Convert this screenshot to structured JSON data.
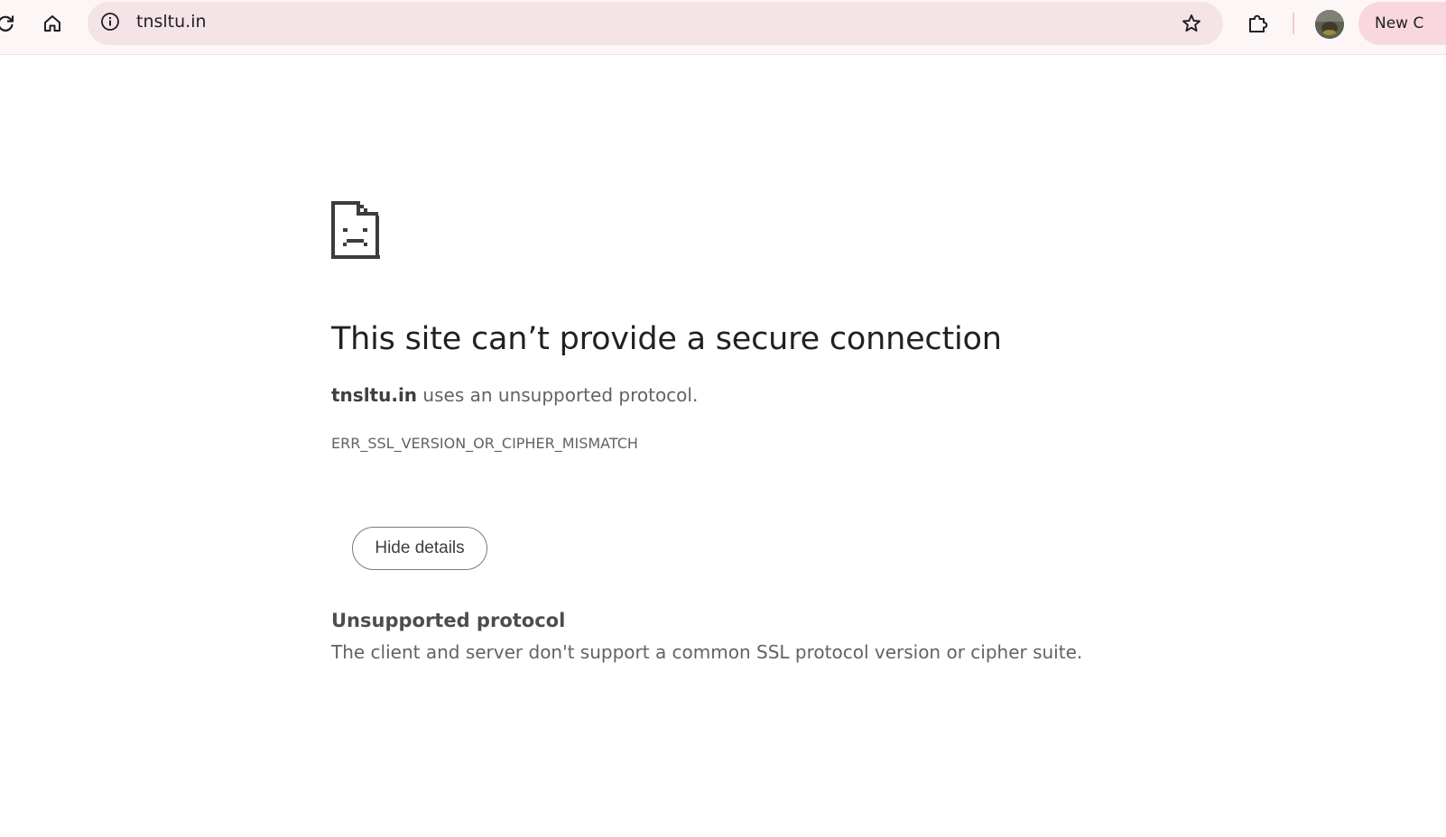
{
  "browser": {
    "url": "tnsltu.in",
    "new_chip_label": "New C",
    "icons": {
      "reload": "reload-icon",
      "home": "home-icon",
      "site_info": "info-icon",
      "bookmark": "star-icon",
      "extensions": "puzzle-icon",
      "avatar": "profile-avatar"
    },
    "colors": {
      "toolbar_bg": "#fdf6f7",
      "omnibox_bg": "#f4e3e7",
      "chip_bg": "#f8d8de"
    }
  },
  "error_page": {
    "icon": "sad-page-icon",
    "heading": "This site can’t provide a secure connection",
    "summary": {
      "host": "tnsltu.in",
      "text": " uses an unsupported protocol."
    },
    "error_code": "ERR_SSL_VERSION_OR_CIPHER_MISMATCH",
    "details_button_label": "Hide details",
    "details": {
      "heading": "Unsupported protocol",
      "text": "The client and server don't support a common SSL protocol version or cipher suite."
    }
  }
}
